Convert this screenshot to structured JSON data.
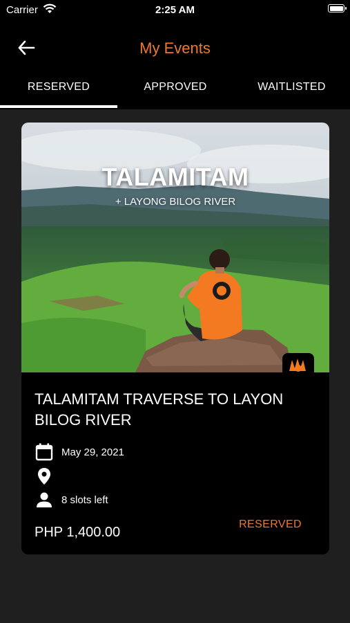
{
  "status_bar": {
    "carrier": "Carrier",
    "time": "2:25 AM"
  },
  "header": {
    "title": "My Events",
    "back_icon": "arrow-left-icon"
  },
  "tabs": [
    {
      "label": "RESERVED",
      "active": true
    },
    {
      "label": "APPROVED",
      "active": false
    },
    {
      "label": "WAITLISTED",
      "active": false
    }
  ],
  "event": {
    "image_title": "TALAMITAM",
    "image_subtitle": "+ LAYONG BILOG RIVER",
    "title": "TALAMITAM TRAVERSE TO LAYON BILOG RIVER",
    "date": "May 29, 2021",
    "location": "",
    "slots": "8 slots left",
    "price": "PHP 1,400.00",
    "status": "RESERVED"
  },
  "colors": {
    "accent": "#f0782a",
    "background": "#1f1f1f",
    "bar": "#000000"
  }
}
